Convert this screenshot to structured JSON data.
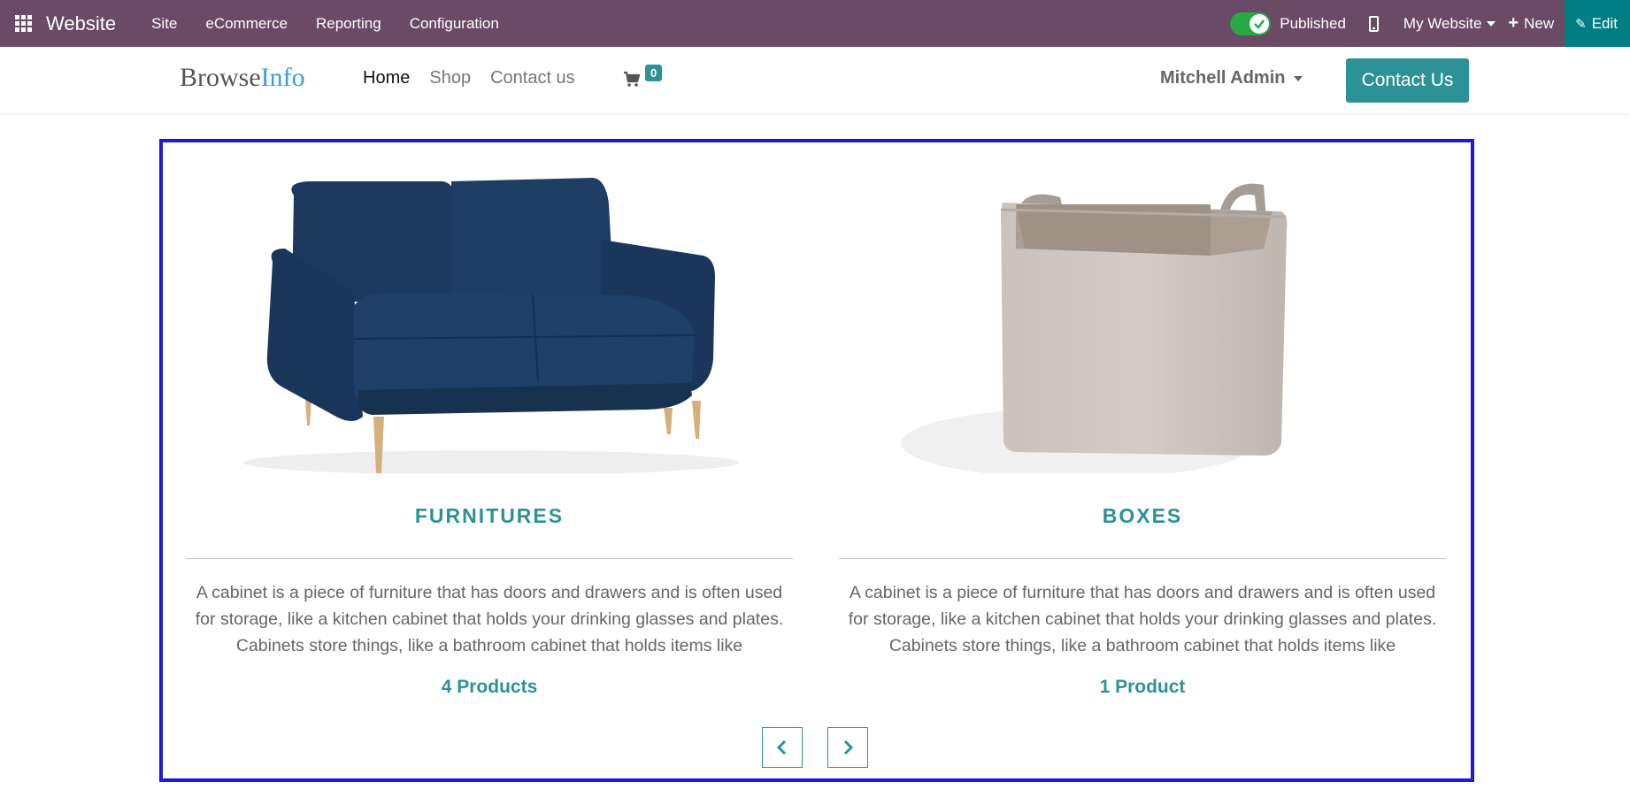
{
  "topbar": {
    "app_name": "Website",
    "menu": [
      "Site",
      "eCommerce",
      "Reporting",
      "Configuration"
    ],
    "published_label": "Published",
    "website_label": "My Website",
    "new_label": "New",
    "edit_label": "Edit"
  },
  "header": {
    "logo_part1": "Browse",
    "logo_part2": "Info",
    "nav": [
      "Home",
      "Shop",
      "Contact us"
    ],
    "cart_count": "0",
    "user_name": "Mitchell Admin",
    "contact_button": "Contact Us"
  },
  "carousel": {
    "cards": [
      {
        "title": "FURNITURES",
        "description": "A cabinet is a piece of furniture that has doors and drawers and is often used for storage, like a kitchen cabinet that holds your drinking glasses and plates. Cabinets store things, like a bathroom cabinet that holds items like",
        "count": "4 Products"
      },
      {
        "title": "BOXES",
        "description": "A cabinet is a piece of furniture that has doors and drawers and is often used for storage, like a kitchen cabinet that holds your drinking glasses and plates. Cabinets store things, like a bathroom cabinet that holds items like",
        "count": "1 Product"
      }
    ]
  },
  "colors": {
    "topbar": "#6b4a65",
    "accent": "#2d9296",
    "edit_bg": "#017e84",
    "selection_border": "#1b1bd8"
  }
}
